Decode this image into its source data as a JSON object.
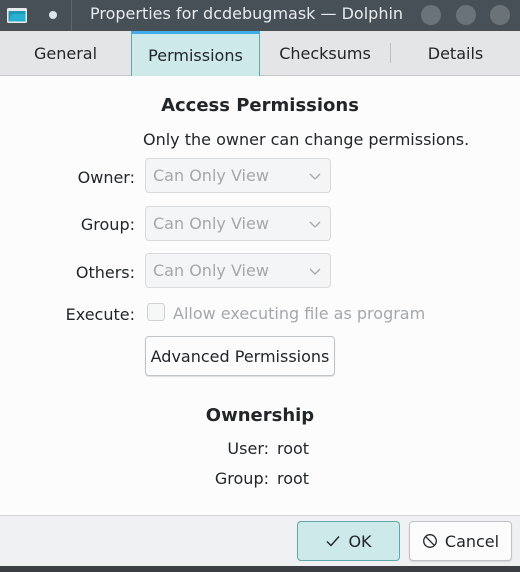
{
  "window": {
    "title": "Properties for dcdebugmask — Dolphin"
  },
  "tabs": [
    {
      "label": "General",
      "active": false
    },
    {
      "label": "Permissions",
      "active": true
    },
    {
      "label": "Checksums",
      "active": false
    },
    {
      "label": "Details",
      "active": false
    }
  ],
  "permissions": {
    "heading": "Access Permissions",
    "note": "Only the owner can change permissions.",
    "owner_label": "Owner:",
    "owner_value": "Can Only View",
    "group_label": "Group:",
    "group_value": "Can Only View",
    "others_label": "Others:",
    "others_value": "Can Only View",
    "execute_label": "Execute:",
    "execute_checkbox_label": "Allow executing file as program",
    "execute_checked": false,
    "advanced_button": "Advanced Permissions"
  },
  "ownership": {
    "heading": "Ownership",
    "user_label": "User:",
    "user_value": "root",
    "group_label": "Group:",
    "group_value": "root"
  },
  "buttons": {
    "ok": "OK",
    "cancel": "Cancel"
  },
  "colors": {
    "accent": "#3daee9",
    "active_tab_bg": "#cde9ea",
    "titlebar": "#475057"
  },
  "icons": {
    "app": "dolphin-folder-icon",
    "ok": "checkmark-icon",
    "cancel": "cancel-circle-icon",
    "combo": "chevron-down-icon"
  }
}
